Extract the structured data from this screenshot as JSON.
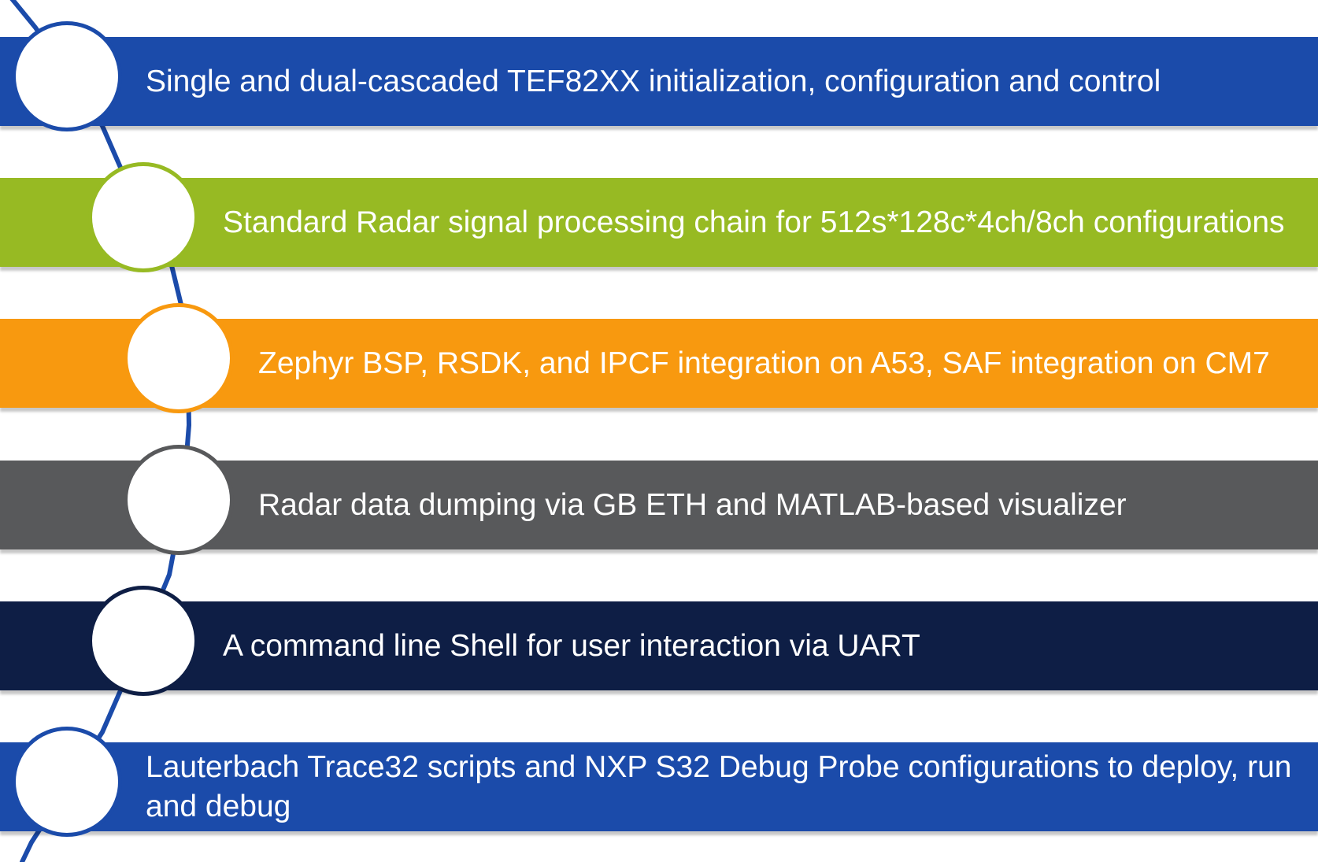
{
  "items": [
    {
      "label": "Single and dual-cascaded TEF82XX initialization, configuration and control",
      "color": "#1B4BAA"
    },
    {
      "label": "Standard Radar signal processing chain for 512s*128c*4ch/8ch configurations",
      "color": "#97BA23"
    },
    {
      "label": "Zephyr BSP, RSDK, and IPCF integration on A53, SAF integration on CM7",
      "color": "#F8990F"
    },
    {
      "label": "Radar data dumping via GB ETH and MATLAB-based visualizer",
      "color": "#58595B"
    },
    {
      "label": "A command line Shell for user interaction via UART",
      "color": "#0E1E45"
    },
    {
      "label": "Lauterbach Trace32 scripts and NXP S32 Debug Probe configurations to deploy, run and debug",
      "color": "#1B4BAA"
    }
  ],
  "spine_color": "#1B4BAA"
}
